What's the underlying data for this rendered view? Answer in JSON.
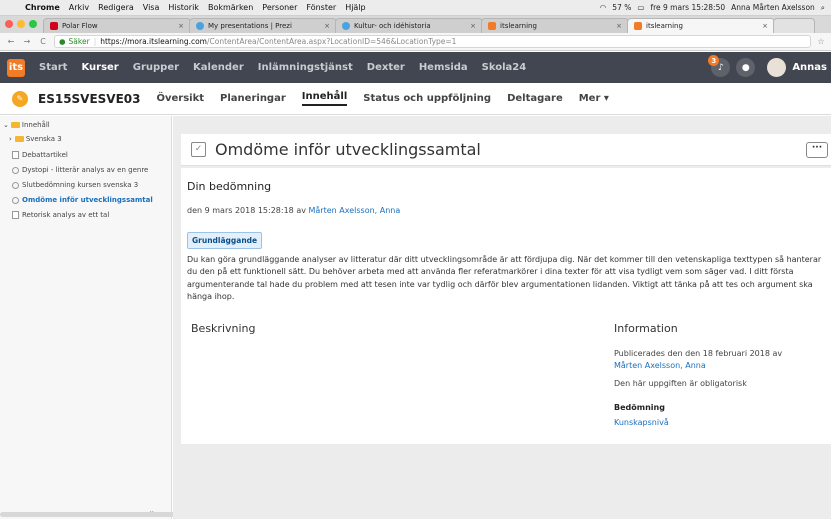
{
  "macmenu": {
    "items": [
      "Chrome",
      "Arkiv",
      "Redigera",
      "Visa",
      "Historik",
      "Bokmärken",
      "Personer",
      "Fönster",
      "Hjälp"
    ],
    "battery": "57 %",
    "clock": "fre 9 mars  15:28:50",
    "user": "Anna Mårten Axelsson"
  },
  "tabs": [
    {
      "label": "Polar Flow",
      "color": "#d0021b"
    },
    {
      "label": "My presentations | Prezi",
      "color": "#4aa3df"
    },
    {
      "label": "Kultur- och idéhistoria",
      "color": "#4aa3df"
    },
    {
      "label": "itslearning",
      "color": "#f27b27"
    },
    {
      "label": "itslearning",
      "color": "#f27b27"
    }
  ],
  "address": {
    "secure": "Säker",
    "host": "https://mora.itslearning.com",
    "path": "/ContentArea/ContentArea.aspx?LocationID=546&LocationType=1"
  },
  "topnav": {
    "logo": "its",
    "items": [
      "Start",
      "Kurser",
      "Grupper",
      "Kalender",
      "Inlämningstjänst",
      "Dexter",
      "Hemsida",
      "Skola24"
    ],
    "active_index": 1,
    "notification_count": "3",
    "user": "Annas"
  },
  "course": {
    "code": "ES15SVESVE03",
    "tabs": [
      "Översikt",
      "Planeringar",
      "Innehåll",
      "Status och uppföljning",
      "Deltagare",
      "Mer ▾"
    ],
    "active_index": 2
  },
  "sidebar": {
    "root": "Innehåll",
    "folder": "Svenska 3",
    "items": [
      "Debattartikel",
      "Dystopi - litterär analys av en genre",
      "Slutbedömning kursen svenska 3",
      "Omdöme inför utvecklingssamtal",
      "Retorisk analys av ett tal"
    ],
    "selected_index": 3
  },
  "page": {
    "title": "Omdöme inför utvecklingssamtal",
    "more": "···",
    "assessment_heading": "Din bedömning",
    "date_prefix": "den 9 mars 2018 15:28:18 av",
    "assessor": "Mårten Axelsson, Anna",
    "grade": "Grundläggande",
    "comment": "Du kan göra grundläggande analyser av litteratur där ditt utvecklingsområde är att fördjupa dig. När det kommer till den vetenskapliga texttypen så hanterar du den på ett funktionell sätt. Du behöver arbeta med att använda fler referatmarkörer i dina texter för att visa tydligt vem som säger vad. I ditt första argumenterande tal hade du problem med att tesen inte var tydlig och därför blev argumentationen lidanden. Viktigt att tänka på att tes och argument ska hänga ihop.",
    "description_heading": "Beskrivning",
    "info_heading": "Information",
    "published_prefix": "Publicerades den den 18 februari 2018 av",
    "publisher": "Mårten Axelsson, Anna",
    "mandatory": "Den här uppgiften är obligatorisk",
    "assessment_label": "Bedömning",
    "assessment_value": "Kunskapsnivå"
  }
}
